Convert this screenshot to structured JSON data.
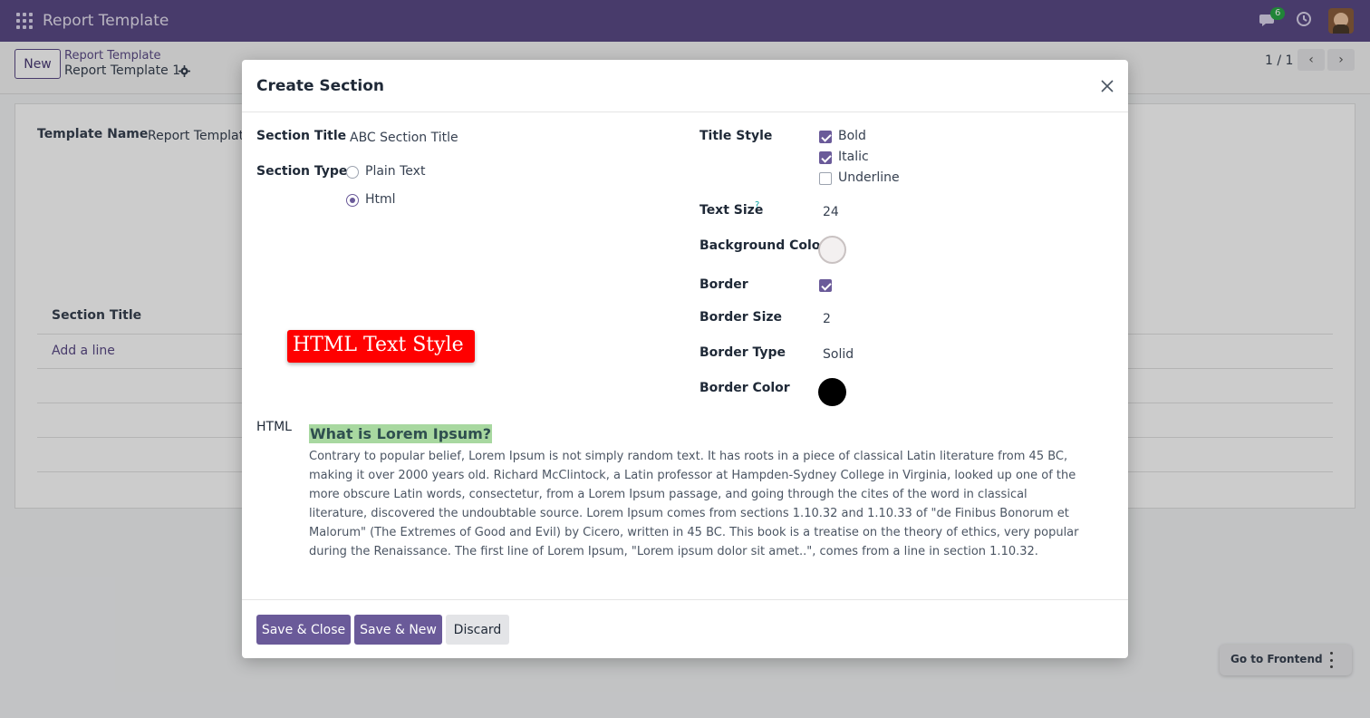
{
  "navbar": {
    "app_title": "Report Template",
    "chat_badge": "6",
    "icons": [
      "apps-icon",
      "chat-icon",
      "clock-icon",
      "avatar"
    ]
  },
  "control_panel": {
    "new_label": "New",
    "breadcrumb_parent": "Report Template",
    "breadcrumb_current": "Report Template 1",
    "pager_value": "1 / 1",
    "pager_prev": "‹",
    "pager_next": "›"
  },
  "background_form": {
    "template_name_label": "Template Name",
    "template_name_value": "Report Template",
    "section_title_header": "Section Title",
    "add_line": "Add a line"
  },
  "modal": {
    "title": "Create Section",
    "close": "×",
    "section_title_label": "Section Title",
    "section_title_value": "ABC Section Title",
    "section_type_label": "Section Type",
    "section_type_options": [
      {
        "label": "Plain Text",
        "selected": false
      },
      {
        "label": "Html",
        "selected": true
      }
    ],
    "title_style_label": "Title Style",
    "title_style_options": [
      {
        "label": "Bold",
        "checked": true
      },
      {
        "label": "Italic",
        "checked": true
      },
      {
        "label": "Underline",
        "checked": false
      }
    ],
    "text_size_label": "Text Size",
    "text_size_help": "?",
    "text_size_value": "24",
    "background_color_label": "Background Color",
    "background_color": "#f3f0f0",
    "border_label": "Border",
    "border_checked": true,
    "border_size_label": "Border Size",
    "border_size_value": "2",
    "border_type_label": "Border Type",
    "border_type_value": "Solid",
    "border_color_label": "Border Color",
    "border_color": "#000000",
    "preview_text": "HTML Text Style",
    "preview_color": "#ff0000",
    "html_label": "HTML",
    "html_heading": "What is Lorem Ipsum?",
    "html_body": "Contrary to popular belief, Lorem Ipsum is not simply random text. It has roots in a piece of classical Latin literature from 45 BC, making it over 2000 years old. Richard McClintock, a Latin professor at Hampden-Sydney College in Virginia, looked up one of the more obscure Latin words, consectetur, from a Lorem Ipsum passage, and going through the cites of the word in classical literature, discovered the undoubtable source. Lorem Ipsum comes from sections 1.10.32 and 1.10.33 of \"de Finibus Bonorum et Malorum\" (The Extremes of Good and Evil) by Cicero, written in 45 BC. This book is a treatise on the theory of ethics, very popular during the Renaissance. The first line of Lorem Ipsum, \"Lorem ipsum dolor sit amet..\", comes from a line in section 1.10.32.",
    "footer": {
      "save_close": "Save & Close",
      "save_new": "Save & New",
      "discard": "Discard"
    }
  },
  "floating": {
    "go_to_frontend": "Go to Frontend"
  },
  "colors": {
    "brand": "#5b4a86",
    "accent": "#6a5a99"
  }
}
